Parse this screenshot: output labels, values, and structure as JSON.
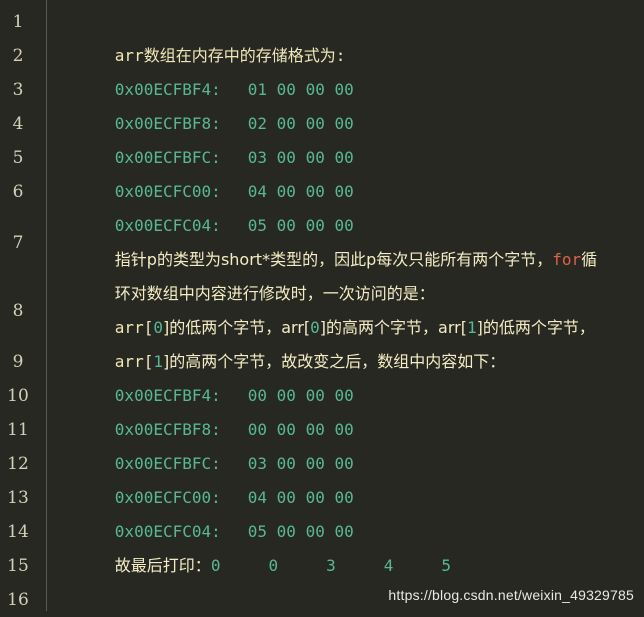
{
  "colors": {
    "background": "#272822",
    "text": "#f0e7b8",
    "address": "#58b894",
    "keyword": "#e0604a",
    "line_number": "#d4d0b8"
  },
  "line_numbers": [
    "1",
    "2",
    "3",
    "4",
    "5",
    "6",
    "7",
    "8",
    "9",
    "10",
    "11",
    "12",
    "13",
    "14",
    "15",
    "16"
  ],
  "lines": {
    "l1": "arr数组在内存中的存储格式为:",
    "l2": {
      "addr": "0x00ECFBF4:",
      "bytes": "01 00 00 00"
    },
    "l3": {
      "addr": "0x00ECFBF8:",
      "bytes": "02 00 00 00"
    },
    "l4": {
      "addr": "0x00ECFBFC:",
      "bytes": "03 00 00 00"
    },
    "l5": {
      "addr": "0x00ECFC00:",
      "bytes": "04 00 00 00"
    },
    "l6": {
      "addr": "0x00ECFC04:",
      "bytes": "05 00 00 00"
    },
    "l7": {
      "part1": "指针p的类型为short*类型的，因此p每次只能所有两个字节，",
      "keyword": "for",
      "part2": "循",
      "part3": "环对数组中内容进行修改时，一次访问的是："
    },
    "l8": {
      "a": "arr[",
      "i0": "0",
      "b": "]的低两个字节，arr[",
      "i1": "0",
      "c": "]的高两个字节，arr[",
      "i2": "1",
      "d": "]的低两个字节，",
      "e": "arr[",
      "i3": "1",
      "f": "]的高两个字节，故改变之后，数组中内容如下："
    },
    "l9": {
      "addr": "0x00ECFBF4:",
      "bytes": "00 00 00 00"
    },
    "l10": {
      "addr": "0x00ECFBF8:",
      "bytes": "00 00 00 00"
    },
    "l11": {
      "addr": "0x00ECFBFC:",
      "bytes": "03 00 00 00"
    },
    "l12": {
      "addr": "0x00ECFC00:",
      "bytes": "04 00 00 00"
    },
    "l13": {
      "addr": "0x00ECFC04:",
      "bytes": "05 00 00 00"
    },
    "l14": {
      "label": "故最后打印：",
      "values": [
        "0",
        "0",
        "3",
        "4",
        "5"
      ]
    },
    "l15": "",
    "l16": ""
  },
  "watermark": "https://blog.csdn.net/weixin_49329785"
}
